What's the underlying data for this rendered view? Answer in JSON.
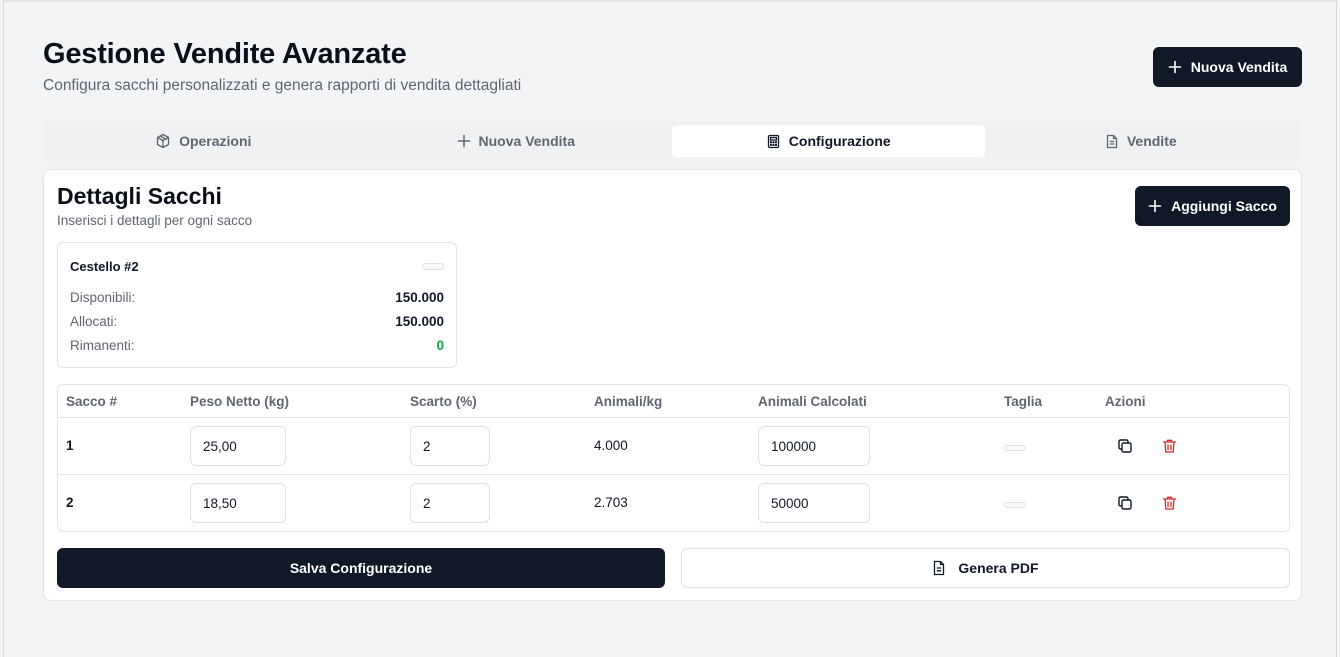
{
  "header": {
    "title": "Gestione Vendite Avanzate",
    "subtitle": "Configura sacchi personalizzati e genera rapporti di vendita dettagliati",
    "new_sale_button": "Nuova Vendita"
  },
  "tabs": [
    {
      "label": "Operazioni",
      "icon": "package-icon",
      "active": false
    },
    {
      "label": "Nuova Vendita",
      "icon": "plus-icon",
      "active": false
    },
    {
      "label": "Configurazione",
      "icon": "calculator-icon",
      "active": true
    },
    {
      "label": "Vendite",
      "icon": "document-icon",
      "active": false
    }
  ],
  "details": {
    "title": "Dettagli Sacchi",
    "subtitle": "Inserisci i dettagli per ogni sacco",
    "add_button": "Aggiungi Sacco"
  },
  "stock": {
    "name": "Cestello #2",
    "rows": [
      {
        "label": "Disponibili:",
        "value": "150.000"
      },
      {
        "label": "Allocati:",
        "value": "150.000"
      },
      {
        "label": "Rimanenti:",
        "value": "0"
      }
    ],
    "remaining_color": "#16a34a"
  },
  "table": {
    "headers": [
      "Sacco #",
      "Peso Netto (kg)",
      "Scarto (%)",
      "Animali/kg",
      "Animali Calcolati",
      "Taglia",
      "Azioni"
    ],
    "rows": [
      {
        "sacco": "1",
        "peso": "25,00",
        "scarto": "2",
        "animali_kg": "4.000",
        "animali_calcolati": "100000"
      },
      {
        "sacco": "2",
        "peso": "18,50",
        "scarto": "2",
        "animali_kg": "2.703",
        "animali_calcolati": "50000"
      }
    ]
  },
  "actions": {
    "save_button": "Salva Configurazione",
    "pdf_button": "Genera PDF"
  },
  "colors": {
    "primary": "#111827",
    "danger": "#dc2626",
    "success": "#16a34a"
  }
}
